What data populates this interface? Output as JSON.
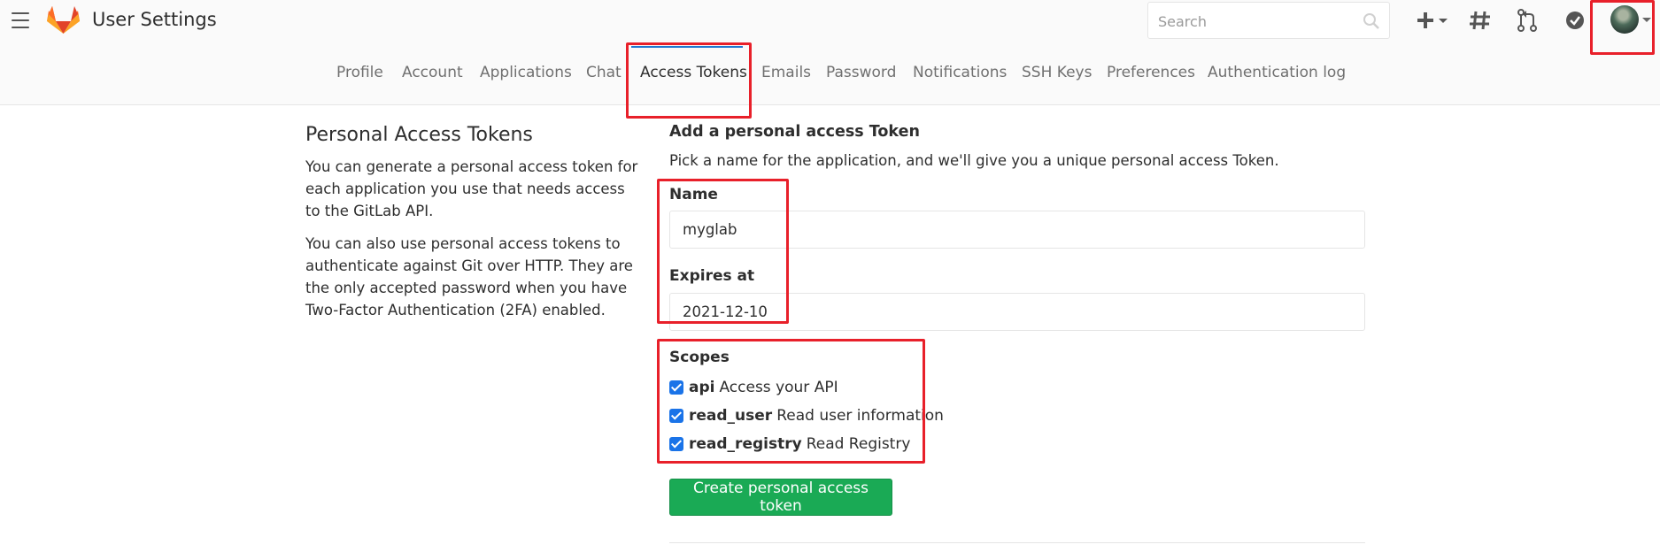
{
  "header": {
    "title": "User Settings",
    "search_placeholder": "Search",
    "icons": [
      "menu-icon",
      "gitlab-logo",
      "search-icon",
      "plus-icon",
      "hash-icon",
      "merge-request-icon",
      "todo-icon",
      "avatar"
    ]
  },
  "tabs": [
    {
      "label": "Profile"
    },
    {
      "label": "Account"
    },
    {
      "label": "Applications"
    },
    {
      "label": "Chat"
    },
    {
      "label": "Access Tokens",
      "active": true
    },
    {
      "label": "Emails"
    },
    {
      "label": "Password"
    },
    {
      "label": "Notifications"
    },
    {
      "label": "SSH Keys"
    },
    {
      "label": "Preferences"
    },
    {
      "label": "Authentication log"
    }
  ],
  "sidebar": {
    "title": "Personal Access Tokens",
    "p1": "You can generate a personal access token for each application you use that needs access to the GitLab API.",
    "p2": "You can also use personal access tokens to authenticate against Git over HTTP. They are the only accepted password when you have Two-Factor Authentication (2FA) enabled."
  },
  "form": {
    "title": "Add a personal access Token",
    "help": "Pick a name for the application, and we'll give you a unique personal access Token.",
    "name_label": "Name",
    "name_value": "myglab",
    "expires_label": "Expires at",
    "expires_value": "2021-12-10",
    "scopes_label": "Scopes",
    "scopes": [
      {
        "name": "api",
        "description": "Access your API",
        "checked": true
      },
      {
        "name": "read_user",
        "description": "Read user information",
        "checked": true
      },
      {
        "name": "read_registry",
        "description": "Read Registry",
        "checked": true
      }
    ],
    "submit_label": "Create personal access token"
  },
  "colors": {
    "accent": "#1f78d1",
    "submit": "#1aaa55",
    "highlight": "#e8202a"
  }
}
